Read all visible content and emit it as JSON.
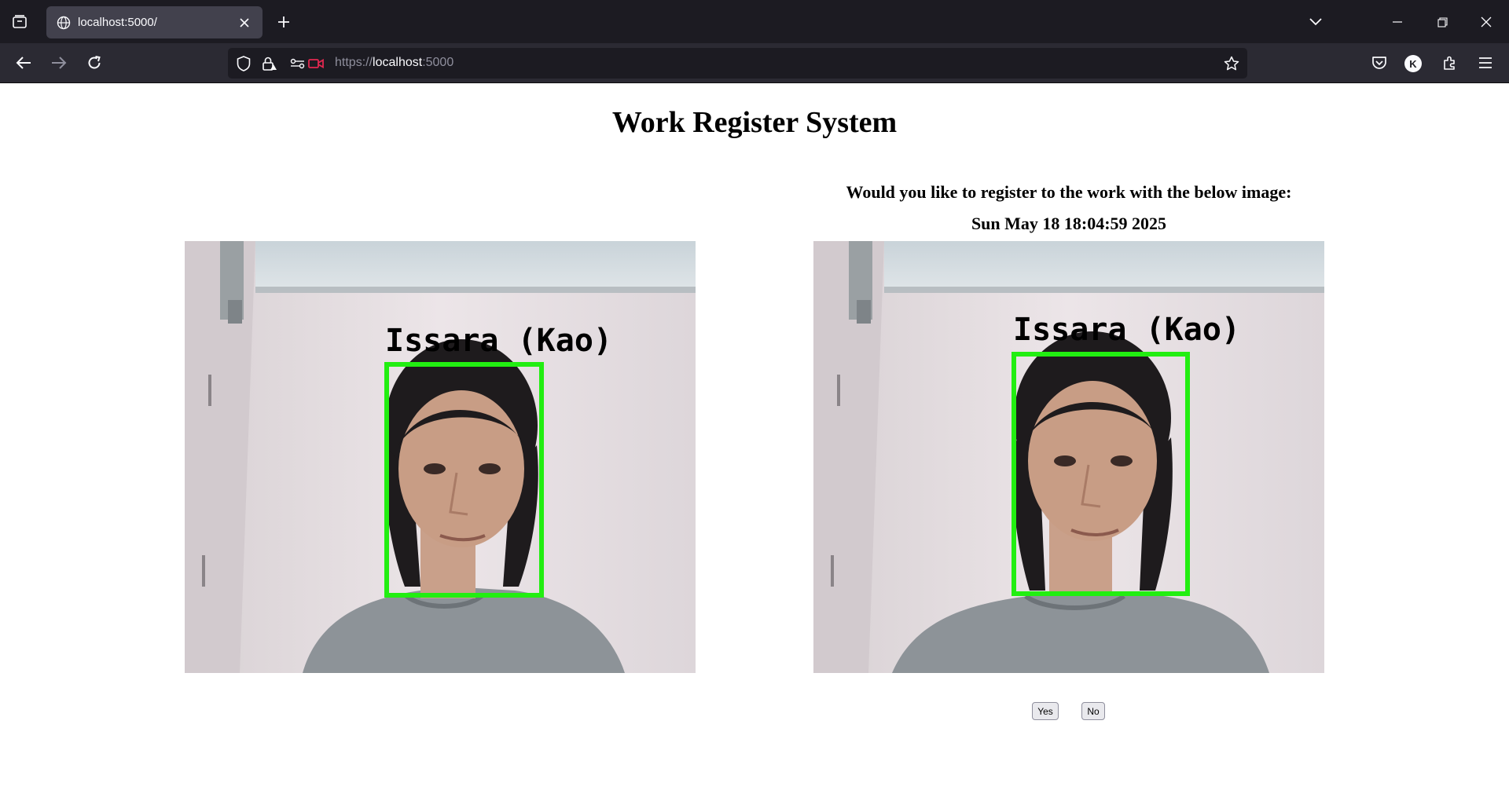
{
  "browser": {
    "tab_title": "localhost:5000/",
    "url_scheme": "https://",
    "url_host": "localhost",
    "url_port": ":5000",
    "profile_initial": "K",
    "icons": {
      "tab_list": "tab-list-icon",
      "globe": "globe-icon",
      "close": "close-icon",
      "new_tab": "plus-icon",
      "overflow": "chevron-down-icon",
      "back": "back-arrow-icon",
      "forward": "forward-arrow-icon",
      "reload": "reload-icon",
      "shield": "shield-icon",
      "lock": "lock-icon",
      "permissions": "permissions-icon",
      "camera": "camera-icon",
      "bookmark": "star-icon",
      "pocket": "pocket-icon",
      "extensions": "extensions-icon",
      "menu": "hamburger-menu-icon"
    }
  },
  "page": {
    "title": "Work Register System",
    "question": "Would you like to register to the work with the below image:",
    "timestamp": "Sun May 18 18:04:59 2025",
    "left_image": {
      "label": "Issara (Kao)"
    },
    "right_image": {
      "label": "Issara (Kao)"
    },
    "yes_label": "Yes",
    "no_label": "No"
  },
  "colors": {
    "chrome_dark": "#1c1b22",
    "toolbar": "#2b2a33",
    "tab_active": "#42414d",
    "detection_box": "#22ee11",
    "camera_indicator": "#e22850"
  }
}
